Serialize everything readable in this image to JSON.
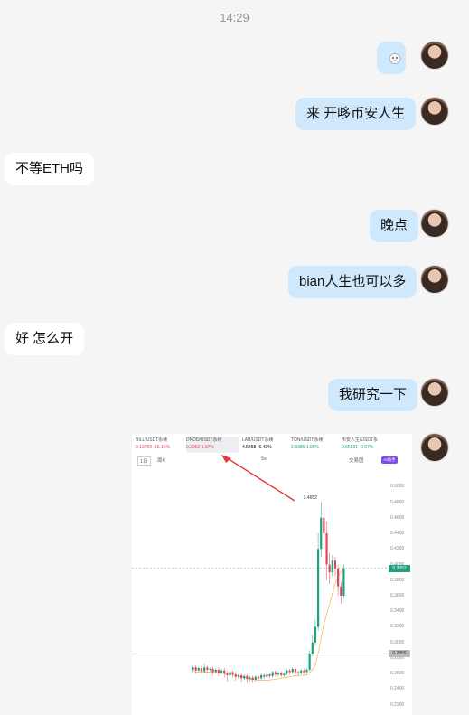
{
  "time": "14:29",
  "messages": [
    {
      "side": "right",
      "text": ""
    },
    {
      "side": "right",
      "text": "来  开哆币安人生"
    },
    {
      "side": "left",
      "text": "不等ETH吗"
    },
    {
      "side": "right",
      "text": "晚点"
    },
    {
      "side": "right",
      "text": "bian人生也可以多"
    },
    {
      "side": "left",
      "text": "好 怎么开"
    },
    {
      "side": "right",
      "text": "我研究一下"
    }
  ],
  "sticker_icon": "seal-emoji-icon",
  "chart_screenshot": {
    "tabs": [
      {
        "name": "BILL/USDT永续",
        "price": "0.13769",
        "change": "-16.16%",
        "trend": "neg"
      },
      {
        "name": "DNDD/USDT永续",
        "price": "0.3952",
        "change": "1.97%",
        "trend": "pos"
      },
      {
        "name": "LAB/USDT永续",
        "price": "4.5458",
        "change": "-6.43%",
        "trend": "neg"
      },
      {
        "name": "TON/USDT永续",
        "price": "2.8385",
        "change": "1.96%",
        "trend": "pos"
      },
      {
        "name": "币安人生/USDT永",
        "price": "0.65931",
        "change": "-0.67%",
        "trend": "neg"
      }
    ],
    "toolbar": {
      "timeframe": "1日",
      "range": "周K",
      "indicator": "5s",
      "layout": "交易图",
      "ai": "AI助手"
    },
    "peak_label": "3.4652",
    "current_price": "0.3952",
    "ref_price": "0.2855",
    "colors": {
      "up": "#1aa37e",
      "down": "#e0475b",
      "ma": "#f2b44a",
      "arrow": "#e23c3c"
    }
  },
  "chart_data": {
    "type": "candlestick",
    "y_ticks": [
      "0.5000",
      "0.4800",
      "0.4600",
      "0.4400",
      "0.4200",
      "0.4000",
      "0.3800",
      "0.3600",
      "0.3400",
      "0.3200",
      "0.3000",
      "0.2800",
      "0.2600",
      "0.2400",
      "0.2200"
    ],
    "ylim": [
      0.215,
      0.505
    ],
    "candles": [
      [
        0.265,
        0.268,
        0.262,
        0.27
      ],
      [
        0.268,
        0.264,
        0.26,
        0.271
      ],
      [
        0.264,
        0.267,
        0.262,
        0.269
      ],
      [
        0.267,
        0.263,
        0.26,
        0.27
      ],
      [
        0.263,
        0.268,
        0.261,
        0.272
      ],
      [
        0.268,
        0.265,
        0.262,
        0.271
      ],
      [
        0.265,
        0.266,
        0.263,
        0.268
      ],
      [
        0.266,
        0.262,
        0.258,
        0.269
      ],
      [
        0.262,
        0.265,
        0.26,
        0.267
      ],
      [
        0.265,
        0.261,
        0.257,
        0.268
      ],
      [
        0.261,
        0.264,
        0.259,
        0.266
      ],
      [
        0.264,
        0.26,
        0.255,
        0.267
      ],
      [
        0.26,
        0.258,
        0.25,
        0.263
      ],
      [
        0.258,
        0.262,
        0.256,
        0.265
      ],
      [
        0.262,
        0.259,
        0.255,
        0.264
      ],
      [
        0.259,
        0.256,
        0.251,
        0.262
      ],
      [
        0.256,
        0.258,
        0.253,
        0.261
      ],
      [
        0.258,
        0.254,
        0.249,
        0.26
      ],
      [
        0.254,
        0.257,
        0.252,
        0.259
      ],
      [
        0.257,
        0.253,
        0.248,
        0.259
      ],
      [
        0.253,
        0.255,
        0.25,
        0.257
      ],
      [
        0.255,
        0.252,
        0.248,
        0.257
      ],
      [
        0.252,
        0.256,
        0.25,
        0.258
      ],
      [
        0.256,
        0.254,
        0.251,
        0.258
      ],
      [
        0.254,
        0.258,
        0.252,
        0.261
      ],
      [
        0.258,
        0.256,
        0.253,
        0.26
      ],
      [
        0.256,
        0.259,
        0.254,
        0.262
      ],
      [
        0.259,
        0.257,
        0.254,
        0.261
      ],
      [
        0.257,
        0.262,
        0.255,
        0.264
      ],
      [
        0.262,
        0.259,
        0.256,
        0.264
      ],
      [
        0.259,
        0.261,
        0.256,
        0.263
      ],
      [
        0.261,
        0.258,
        0.255,
        0.263
      ],
      [
        0.258,
        0.26,
        0.256,
        0.262
      ],
      [
        0.26,
        0.264,
        0.258,
        0.266
      ],
      [
        0.264,
        0.262,
        0.259,
        0.266
      ],
      [
        0.262,
        0.266,
        0.26,
        0.268
      ],
      [
        0.266,
        0.262,
        0.259,
        0.268
      ],
      [
        0.262,
        0.261,
        0.257,
        0.264
      ],
      [
        0.261,
        0.264,
        0.259,
        0.266
      ],
      [
        0.264,
        0.262,
        0.26,
        0.266
      ],
      [
        0.262,
        0.265,
        0.26,
        0.267
      ],
      [
        0.265,
        0.285,
        0.263,
        0.29
      ],
      [
        0.285,
        0.3,
        0.282,
        0.31
      ],
      [
        0.3,
        0.32,
        0.296,
        0.33
      ],
      [
        0.32,
        0.42,
        0.315,
        0.44
      ],
      [
        0.42,
        0.46,
        0.41,
        0.48
      ],
      [
        0.46,
        0.44,
        0.42,
        0.478
      ],
      [
        0.44,
        0.4,
        0.38,
        0.455
      ],
      [
        0.4,
        0.39,
        0.375,
        0.415
      ],
      [
        0.39,
        0.405,
        0.385,
        0.412
      ],
      [
        0.405,
        0.395,
        0.385,
        0.41
      ],
      [
        0.395,
        0.372,
        0.36,
        0.4
      ],
      [
        0.372,
        0.36,
        0.35,
        0.378
      ],
      [
        0.36,
        0.395,
        0.356,
        0.4
      ]
    ]
  }
}
